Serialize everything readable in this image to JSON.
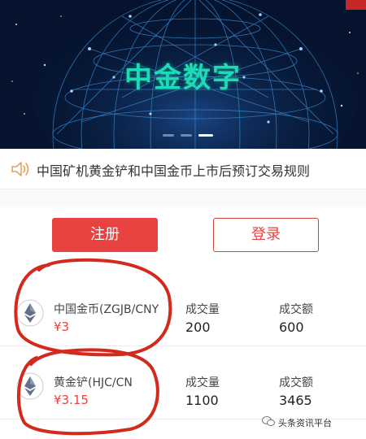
{
  "banner": {
    "title": "中金数字"
  },
  "notice": {
    "icon": "speaker-icon",
    "text": "中国矿机黄金铲和中国金币上市后预订交易规则"
  },
  "actions": {
    "register_label": "注册",
    "login_label": "登录"
  },
  "market": {
    "rows": [
      {
        "icon": "ethereum-icon",
        "name": "中国金币(ZGJB/CNY",
        "price": "¥3",
        "volume_label": "成交量",
        "volume": "200",
        "amount_label": "成交额",
        "amount": "600"
      },
      {
        "icon": "ethereum-icon",
        "name": "黄金铲(HJC/CN",
        "price": "¥3.15",
        "volume_label": "成交量",
        "volume": "1100",
        "amount_label": "成交额",
        "amount": "3465"
      }
    ]
  },
  "watermark": {
    "text": "头条资讯平台"
  },
  "colors": {
    "accent": "#e84340",
    "banner_bg": "#05132e",
    "banner_title": "#1fd9b9",
    "annotation": "#d42a1e"
  }
}
